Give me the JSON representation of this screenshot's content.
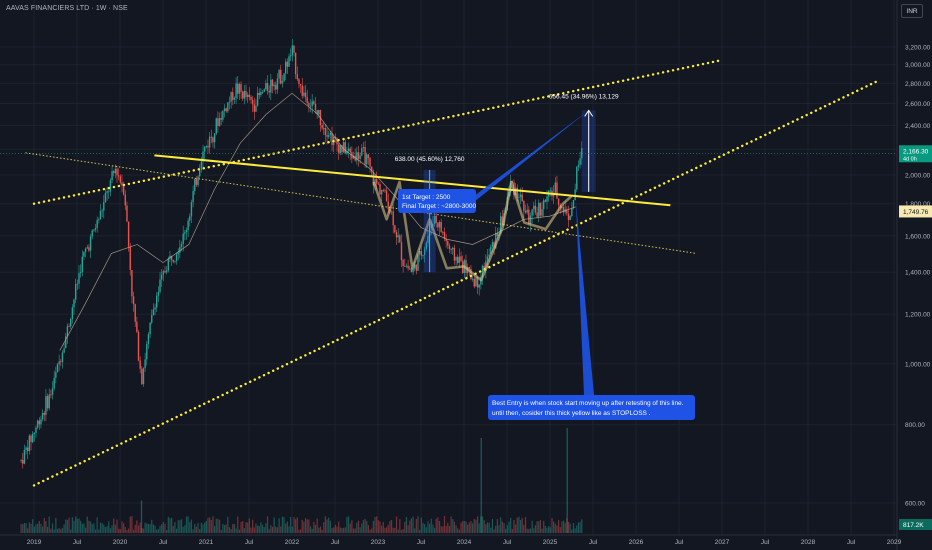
{
  "header": {
    "symbol_title": "AAVAS FINANCIERS LTD · 1W · NSE",
    "currency": "INR"
  },
  "badges": {
    "last_price": "2,166.30",
    "countdown": "4d 0h",
    "marker_price": "1,749.76",
    "volume_value": "817.2K"
  },
  "annotations": {
    "measure_small": "638.00 (45.60%) 12,760",
    "measure_big": "656.45 (34.96%) 13,129",
    "targets_line1": "1st Target : 2500",
    "targets_line2": "Final Target : ~2800-3000",
    "entry_line1": "Best Entry is when stock start moving up after retesting of this line.",
    "entry_line2": "until then, cosider this thick yellow like as STOPLOSS ."
  },
  "colors": {
    "background": "#131722",
    "up": "#26a69a",
    "down": "#ef5350",
    "trendline": "#ffeb3b",
    "note_bg": "#1e53e5",
    "price_badge": "#089981"
  },
  "chart_data": {
    "type": "candlestick",
    "title": "AAVAS FINANCIERS LTD · 1W · NSE",
    "y_scale": "log",
    "y_ticks": [
      600,
      800,
      1000,
      1200,
      1400,
      1600,
      1800,
      2000,
      2200,
      2400,
      2600,
      2800,
      3000,
      3200
    ],
    "y_tick_labels": [
      "600.00",
      "800.00",
      "1,000.00",
      "1,200.00",
      "1,400.00",
      "1,600.00",
      "1,800.00",
      "2,000.00",
      "2,200.00",
      "2,400.00",
      "2,600.00",
      "2,800.00",
      "3,000.00",
      "3,200.00"
    ],
    "x_tick_labels": [
      "2019",
      "Jul",
      "2020",
      "Jul",
      "2021",
      "Jul",
      "2022",
      "Jul",
      "2023",
      "Jul",
      "2024",
      "Jul",
      "2025",
      "Jul",
      "2026",
      "Jul",
      "2027",
      "Jul",
      "2028",
      "Jul",
      "2029"
    ],
    "x_ticks_time": [
      2019.0,
      2019.5,
      2020.0,
      2020.5,
      2021.0,
      2021.5,
      2022.0,
      2022.5,
      2023.0,
      2023.5,
      2024.0,
      2024.5,
      2025.0,
      2025.5,
      2026.0,
      2026.5,
      2027.0,
      2027.5,
      2028.0,
      2028.5,
      2029.0
    ],
    "price_path": [
      [
        2018.85,
        700
      ],
      [
        2019.0,
        780
      ],
      [
        2019.2,
        900
      ],
      [
        2019.4,
        1150
      ],
      [
        2019.55,
        1450
      ],
      [
        2019.75,
        1700
      ],
      [
        2019.95,
        2050
      ],
      [
        2020.05,
        1900
      ],
      [
        2020.15,
        1250
      ],
      [
        2020.25,
        950
      ],
      [
        2020.4,
        1250
      ],
      [
        2020.55,
        1450
      ],
      [
        2020.75,
        1600
      ],
      [
        2020.95,
        2150
      ],
      [
        2021.15,
        2450
      ],
      [
        2021.35,
        2750
      ],
      [
        2021.55,
        2600
      ],
      [
        2021.75,
        2800
      ],
      [
        2021.9,
        2900
      ],
      [
        2022.0,
        3150
      ],
      [
        2022.1,
        2750
      ],
      [
        2022.3,
        2500
      ],
      [
        2022.5,
        2250
      ],
      [
        2022.7,
        2150
      ],
      [
        2022.85,
        2150
      ],
      [
        2022.95,
        1950
      ],
      [
        2023.05,
        1900
      ],
      [
        2023.15,
        1750
      ],
      [
        2023.3,
        1450
      ],
      [
        2023.4,
        1400
      ],
      [
        2023.55,
        1550
      ],
      [
        2023.65,
        1720
      ],
      [
        2023.75,
        1620
      ],
      [
        2023.85,
        1500
      ],
      [
        2023.95,
        1460
      ],
      [
        2024.05,
        1400
      ],
      [
        2024.15,
        1340
      ],
      [
        2024.3,
        1500
      ],
      [
        2024.45,
        1700
      ],
      [
        2024.55,
        1950
      ],
      [
        2024.65,
        1850
      ],
      [
        2024.75,
        1700
      ],
      [
        2024.9,
        1780
      ],
      [
        2025.05,
        1900
      ],
      [
        2025.15,
        1760
      ],
      [
        2025.25,
        1730
      ],
      [
        2025.32,
        2050
      ],
      [
        2025.37,
        2166
      ]
    ],
    "volume_spikes": [
      [
        2020.25,
        650
      ],
      [
        2024.2,
        1900
      ],
      [
        2025.2,
        2100
      ]
    ],
    "moving_average": [
      [
        2019.3,
        1050
      ],
      [
        2019.6,
        1250
      ],
      [
        2019.9,
        1500
      ],
      [
        2020.2,
        1550
      ],
      [
        2020.5,
        1450
      ],
      [
        2020.8,
        1550
      ],
      [
        2021.1,
        1900
      ],
      [
        2021.4,
        2250
      ],
      [
        2021.7,
        2500
      ],
      [
        2022.0,
        2700
      ],
      [
        2022.3,
        2500
      ],
      [
        2022.6,
        2200
      ],
      [
        2022.9,
        2050
      ],
      [
        2023.2,
        1850
      ],
      [
        2023.5,
        1650
      ],
      [
        2023.8,
        1580
      ],
      [
        2024.1,
        1550
      ],
      [
        2024.4,
        1620
      ],
      [
        2024.7,
        1700
      ],
      [
        2025.0,
        1720
      ],
      [
        2025.3,
        1780
      ]
    ],
    "trendlines": {
      "upper_channel": [
        [
          2019.0,
          1800
        ],
        [
          2027.0,
          3050
        ]
      ],
      "lower_channel": [
        [
          2019.0,
          640
        ],
        [
          2028.8,
          2820
        ]
      ],
      "thick_resistance": [
        [
          2020.4,
          2150
        ],
        [
          2026.4,
          1790
        ]
      ],
      "thin_support": [
        [
          2018.9,
          2170
        ],
        [
          2026.7,
          1500
        ]
      ]
    },
    "markers": {
      "last_price": 2166.3,
      "marker_price": 1749.76,
      "measure_small": {
        "x": 2023.6,
        "from": 1400,
        "to": 2038
      },
      "measure_big": {
        "x": 2025.45,
        "from": 1880,
        "to": 2536
      }
    }
  }
}
